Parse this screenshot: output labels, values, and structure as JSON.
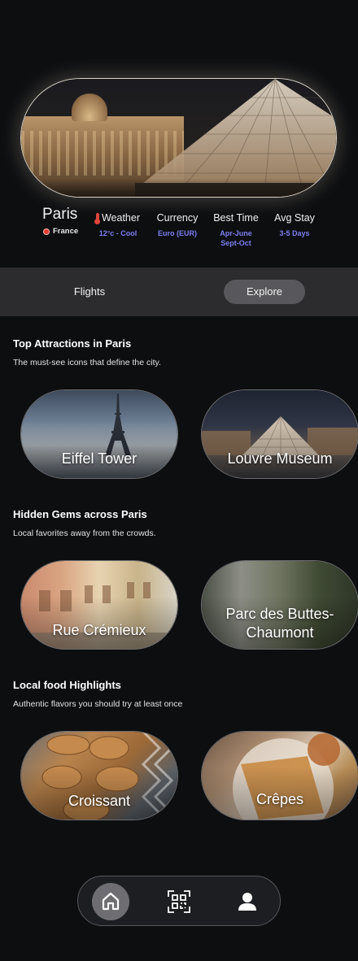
{
  "destination": {
    "city": "Paris",
    "country": "France"
  },
  "info": [
    {
      "label": "Weather",
      "value": "12°c - Cool",
      "icon": "thermometer-icon"
    },
    {
      "label": "Currency",
      "value": "Euro (EUR)"
    },
    {
      "label": "Best Time",
      "value": "Apr-June",
      "value2": "Sept-Oct"
    },
    {
      "label": "Avg Stay",
      "value": "3-5 Days"
    }
  ],
  "tabs": {
    "flights": "Flights",
    "explore": "Explore",
    "active": "Explore"
  },
  "sections": [
    {
      "title": "Top Attractions in Paris",
      "subtitle": "The must-see icons that define the city.",
      "cards": [
        {
          "label": "Eiffel Tower"
        },
        {
          "label": "Louvre Museum"
        }
      ]
    },
    {
      "title": "Hidden Gems across Paris",
      "subtitle": "Local favorites away from the crowds.",
      "cards": [
        {
          "label": "Rue Crémieux"
        },
        {
          "label": "Parc des Buttes-Chaumont"
        }
      ]
    },
    {
      "title": "Local food Highlights",
      "subtitle": "Authentic flavors you should try at least once",
      "cards": [
        {
          "label": "Croissant"
        },
        {
          "label": "Crêpes"
        }
      ]
    }
  ],
  "nav": {
    "items": [
      "home-icon",
      "qr-scan-icon",
      "profile-icon"
    ],
    "active": "home-icon"
  },
  "colors": {
    "background": "#0d0e10",
    "accent": "#7b7ff0",
    "tabbar": "#2c2c2e",
    "active_tab": "#58585c"
  }
}
